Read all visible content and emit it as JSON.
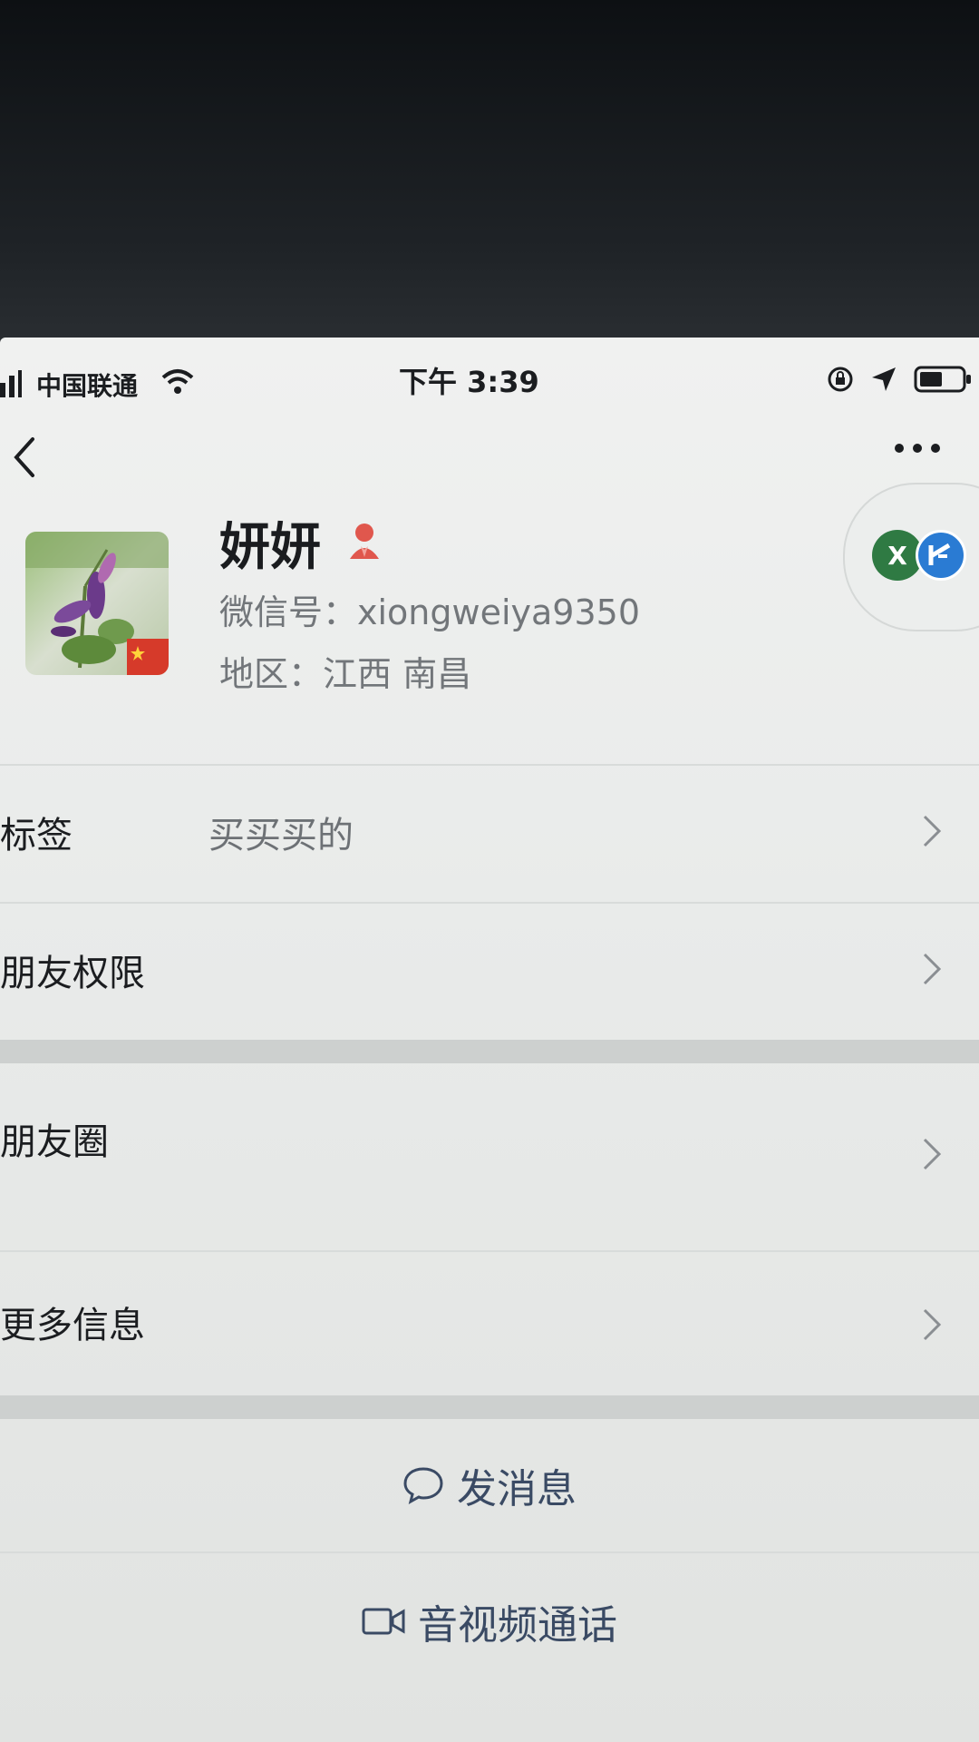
{
  "status_bar": {
    "carrier": "中国联通",
    "time": "下午 3:39"
  },
  "profile": {
    "name": "妍妍",
    "wechat_id": "微信号：xiongweiya9350",
    "region": "地区：江西 南昌"
  },
  "mini_widget": {
    "left_letter": "X"
  },
  "list": {
    "tags_label": "标签",
    "tags_value": "买买买的",
    "permissions_label": "朋友权限",
    "moments_label": "朋友圈",
    "more_info_label": "更多信息"
  },
  "actions": {
    "send_message": "发消息",
    "video_call": "音视频通话"
  },
  "colors": {
    "accent": "#3a4a64",
    "wechat_green": "#2f7a43"
  }
}
